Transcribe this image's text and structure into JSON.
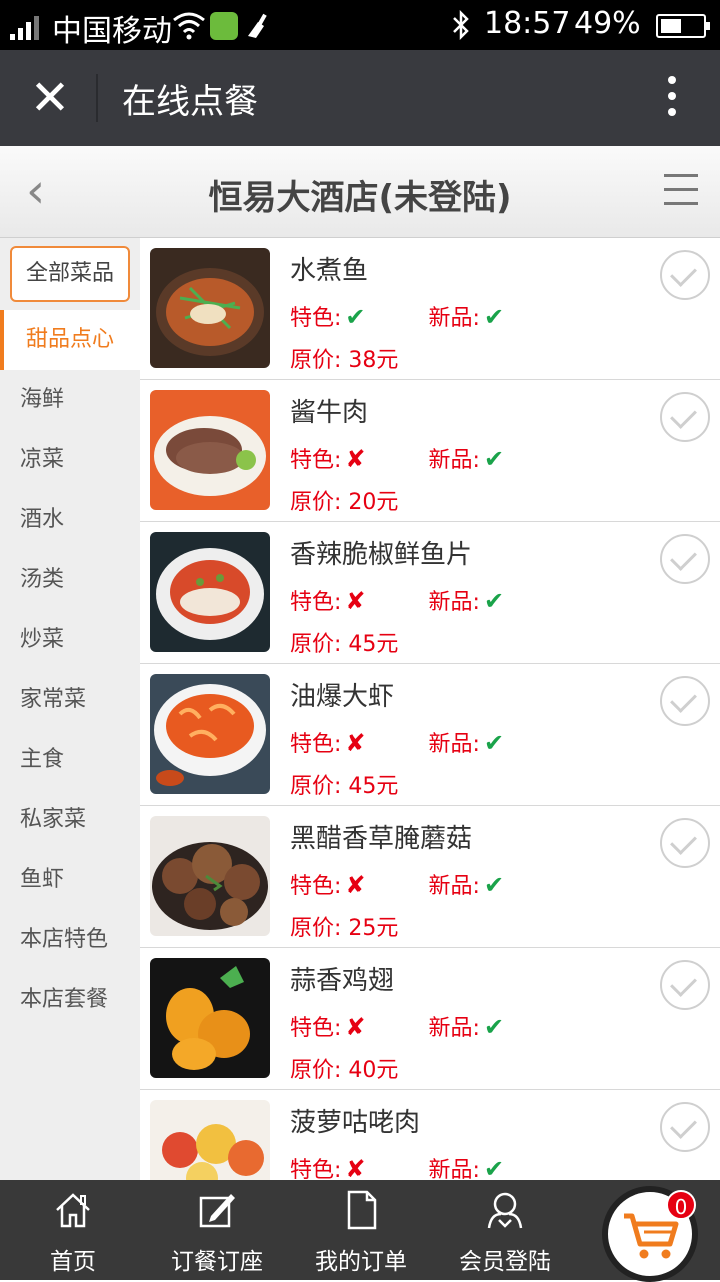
{
  "status_bar": {
    "carrier": "中国移动",
    "time": "18:57",
    "battery": "49%"
  },
  "wx_header": {
    "title": "在线点餐"
  },
  "shop_header": {
    "title": "恒易大酒店(未登陆)"
  },
  "sidebar": {
    "all_label": "全部菜品",
    "categories": [
      {
        "label": "甜品点心",
        "active": true
      },
      {
        "label": "海鲜"
      },
      {
        "label": "凉菜"
      },
      {
        "label": "酒水"
      },
      {
        "label": "汤类"
      },
      {
        "label": "炒菜"
      },
      {
        "label": "家常菜"
      },
      {
        "label": "主食"
      },
      {
        "label": "私家菜"
      },
      {
        "label": "鱼虾"
      },
      {
        "label": "本店特色"
      },
      {
        "label": "本店套餐"
      }
    ]
  },
  "labels": {
    "special": "特色:",
    "new": "新品:"
  },
  "dishes": [
    {
      "name": "水煮鱼",
      "special": true,
      "new": true,
      "price": "原价: 38元"
    },
    {
      "name": "酱牛肉",
      "special": false,
      "new": true,
      "price": "原价: 20元"
    },
    {
      "name": "香辣脆椒鲜鱼片",
      "special": false,
      "new": true,
      "price": "原价: 45元"
    },
    {
      "name": "油爆大虾",
      "special": false,
      "new": true,
      "price": "原价: 45元"
    },
    {
      "name": "黑醋香草腌蘑菇",
      "special": false,
      "new": true,
      "price": "原价: 25元"
    },
    {
      "name": "蒜香鸡翅",
      "special": false,
      "new": true,
      "price": "原价: 40元"
    },
    {
      "name": "菠萝咕咾肉",
      "special": false,
      "new": true,
      "price": ""
    }
  ],
  "bottom_nav": [
    {
      "label": "首页",
      "icon": "home-icon"
    },
    {
      "label": "订餐订座",
      "icon": "edit-icon"
    },
    {
      "label": "我的订单",
      "icon": "document-icon"
    },
    {
      "label": "会员登陆",
      "icon": "member-icon"
    }
  ],
  "cart": {
    "count": "0"
  },
  "colors": {
    "accent": "#f07c1e",
    "price": "#e60012",
    "ok": "#1aa34a",
    "nav_bg": "#393939",
    "wx_bar": "#393a3f"
  }
}
